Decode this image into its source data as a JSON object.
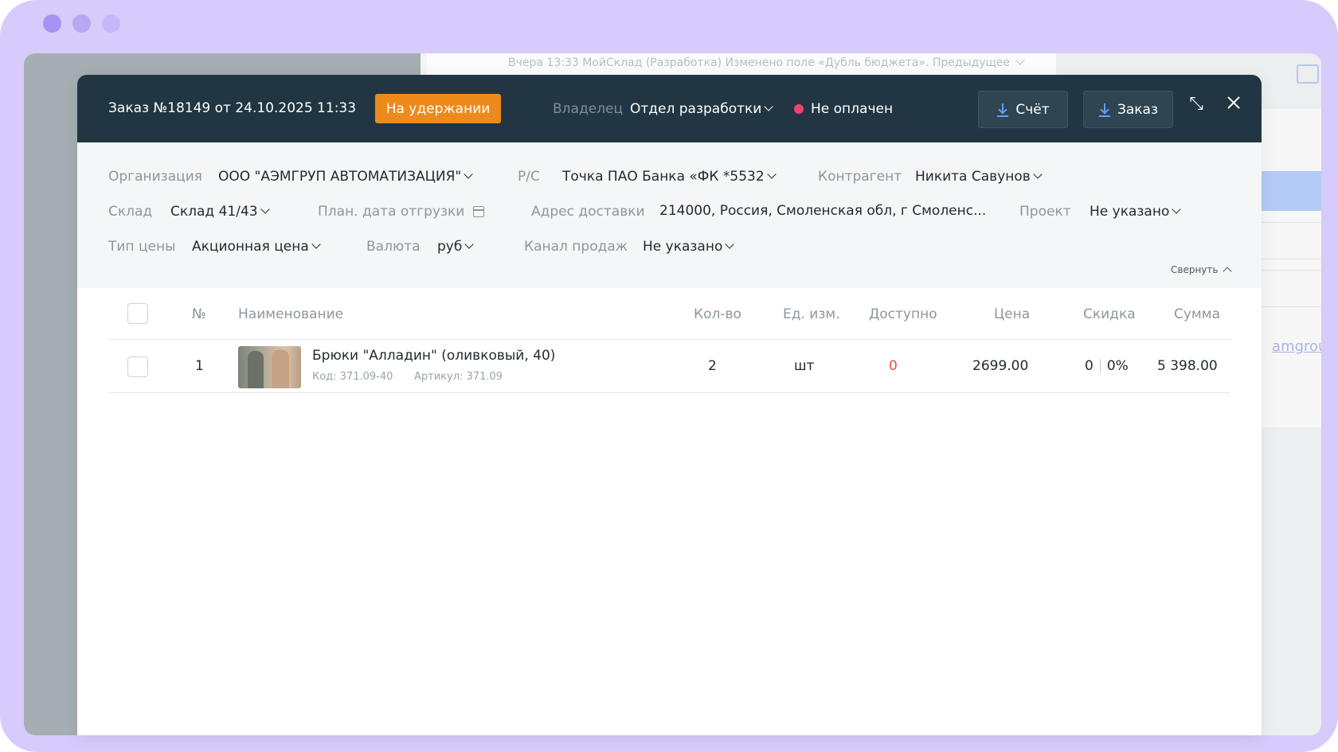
{
  "background": {
    "history_text": "Вчера 13:33 МойСклад (Разработка) Изменено поле «Дубль бюджета». Предыдущее",
    "right_link": "amgrou"
  },
  "header": {
    "order_title": "Заказ №18149 от 24.10.2025 11:33",
    "status": "На удержании",
    "owner_label": "Владелец",
    "owner_value": "Отдел разработки",
    "payment_status": "Не оплачен",
    "invoice_button": "Счёт",
    "order_button": "Заказ"
  },
  "fields": {
    "organization_label": "Организация",
    "organization_value": "ООО \"АЭМГРУП АВТОМАТИЗАЦИЯ\"",
    "account_label": "Р/С",
    "account_value": "Точка ПАО Банка «ФК *5532",
    "counterparty_label": "Контрагент",
    "counterparty_value": "Никита Савунов",
    "warehouse_label": "Склад",
    "warehouse_value": "Склад 41/43",
    "ship_date_label": "План. дата отгрузки",
    "address_label": "Адрес доставки",
    "address_value": "214000, Россия, Смоленская обл, г Смоленс...",
    "project_label": "Проект",
    "project_value": "Не указано",
    "price_type_label": "Тип цены",
    "price_type_value": "Акционная цена",
    "currency_label": "Валюта",
    "currency_value": "руб",
    "channel_label": "Канал продаж",
    "channel_value": "Не указано",
    "collapse_label": "Свернуть"
  },
  "table": {
    "headers": {
      "num": "№",
      "name": "Наименование",
      "qty": "Кол-во",
      "unit": "Ед. изм.",
      "available": "Доступно",
      "price": "Цена",
      "discount": "Скидка",
      "sum": "Сумма"
    },
    "rows": [
      {
        "num": "1",
        "name": "Брюки \"Алладин\" (оливковый, 40)",
        "code": "Код: 371.09-40",
        "article": "Артикул: 371.09",
        "qty": "2",
        "unit": "шт",
        "available": "0",
        "price": "2699.00",
        "discount_value": "0",
        "discount_percent": "0%",
        "sum": "5 398.00"
      }
    ]
  },
  "colors": {
    "header_bg": "#213642",
    "status_orange": "#ee8a1c",
    "unpaid_dot": "#f0426e",
    "download_icon": "#5aa2f2",
    "available_zero": "#f04b4b"
  }
}
